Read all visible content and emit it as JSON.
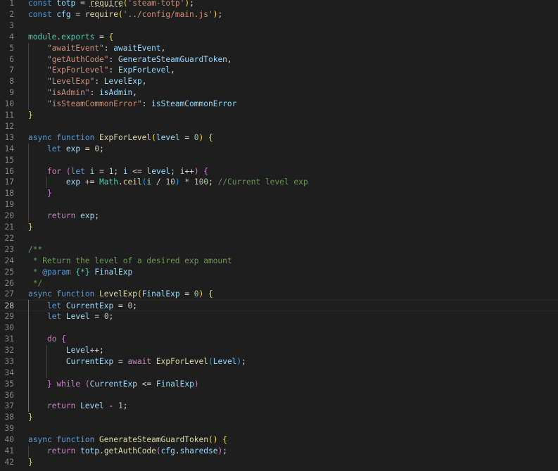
{
  "editor": {
    "lines": [
      {
        "n": "1",
        "t": [
          [
            "const ",
            "#569cd6"
          ],
          [
            "totp",
            "#9cdcfe"
          ],
          [
            " = ",
            "#d4d4d4"
          ],
          [
            "require",
            "#dcdcaa"
          ],
          [
            "(",
            "#ffd700"
          ],
          [
            "'steam-totp'",
            "#ce9178"
          ],
          [
            ")",
            "#ffd700"
          ],
          [
            ";",
            "#d4d4d4"
          ]
        ]
      },
      {
        "n": "2",
        "t": [
          [
            "const ",
            "#569cd6"
          ],
          [
            "cfg",
            "#9cdcfe"
          ],
          [
            " = ",
            "#d4d4d4"
          ],
          [
            "require",
            "#dcdcaa"
          ],
          [
            "(",
            "#ffd700"
          ],
          [
            "'../config/main.js'",
            "#ce9178"
          ],
          [
            ")",
            "#ffd700"
          ],
          [
            ";",
            "#d4d4d4"
          ]
        ]
      },
      {
        "n": "3",
        "t": []
      },
      {
        "n": "4",
        "t": [
          [
            "module",
            "#4ec9b0"
          ],
          [
            ".",
            "#d4d4d4"
          ],
          [
            "exports",
            "#4ec9b0"
          ],
          [
            " = ",
            "#d4d4d4"
          ],
          [
            "{",
            "#ffd700"
          ]
        ]
      },
      {
        "n": "5",
        "t": [
          [
            "    ",
            "#d4d4d4"
          ],
          [
            "\"awaitEvent\"",
            "#ce9178"
          ],
          [
            ": ",
            "#d4d4d4"
          ],
          [
            "awaitEvent",
            "#9cdcfe"
          ],
          [
            ",",
            "#d4d4d4"
          ]
        ]
      },
      {
        "n": "6",
        "t": [
          [
            "    ",
            "#d4d4d4"
          ],
          [
            "\"getAuthCode\"",
            "#ce9178"
          ],
          [
            ": ",
            "#d4d4d4"
          ],
          [
            "GenerateSteamGuardToken",
            "#9cdcfe"
          ],
          [
            ",",
            "#d4d4d4"
          ]
        ]
      },
      {
        "n": "7",
        "t": [
          [
            "    ",
            "#d4d4d4"
          ],
          [
            "\"ExpForLevel\"",
            "#ce9178"
          ],
          [
            ": ",
            "#d4d4d4"
          ],
          [
            "ExpForLevel",
            "#9cdcfe"
          ],
          [
            ",",
            "#d4d4d4"
          ]
        ]
      },
      {
        "n": "8",
        "t": [
          [
            "    ",
            "#d4d4d4"
          ],
          [
            "\"LevelExp\"",
            "#ce9178"
          ],
          [
            ": ",
            "#d4d4d4"
          ],
          [
            "LevelExp",
            "#9cdcfe"
          ],
          [
            ",",
            "#d4d4d4"
          ]
        ]
      },
      {
        "n": "9",
        "t": [
          [
            "    ",
            "#d4d4d4"
          ],
          [
            "\"isAdmin\"",
            "#ce9178"
          ],
          [
            ": ",
            "#d4d4d4"
          ],
          [
            "isAdmin",
            "#9cdcfe"
          ],
          [
            ",",
            "#d4d4d4"
          ]
        ]
      },
      {
        "n": "10",
        "t": [
          [
            "    ",
            "#d4d4d4"
          ],
          [
            "\"isSteamCommonError\"",
            "#ce9178"
          ],
          [
            ": ",
            "#d4d4d4"
          ],
          [
            "isSteamCommonError",
            "#9cdcfe"
          ]
        ]
      },
      {
        "n": "11",
        "t": [
          [
            "}",
            "#ffd700"
          ]
        ]
      },
      {
        "n": "12",
        "t": []
      },
      {
        "n": "13",
        "t": [
          [
            "async ",
            "#569cd6"
          ],
          [
            "function ",
            "#569cd6"
          ],
          [
            "ExpForLevel",
            "#dcdcaa"
          ],
          [
            "(",
            "#ffd700"
          ],
          [
            "level",
            "#9cdcfe"
          ],
          [
            " = ",
            "#d4d4d4"
          ],
          [
            "0",
            "#b5cea8"
          ],
          [
            ")",
            "#ffd700"
          ],
          [
            " ",
            "#d4d4d4"
          ],
          [
            "{",
            "#ffd700"
          ]
        ]
      },
      {
        "n": "14",
        "t": [
          [
            "    ",
            "#d4d4d4"
          ],
          [
            "let ",
            "#569cd6"
          ],
          [
            "exp",
            "#9cdcfe"
          ],
          [
            " = ",
            "#d4d4d4"
          ],
          [
            "0",
            "#b5cea8"
          ],
          [
            ";",
            "#d4d4d4"
          ]
        ]
      },
      {
        "n": "15",
        "t": []
      },
      {
        "n": "16",
        "t": [
          [
            "    ",
            "#d4d4d4"
          ],
          [
            "for ",
            "#c586c0"
          ],
          [
            "(",
            "#da70d6"
          ],
          [
            "let ",
            "#569cd6"
          ],
          [
            "i",
            "#9cdcfe"
          ],
          [
            " = ",
            "#d4d4d4"
          ],
          [
            "1",
            "#b5cea8"
          ],
          [
            "; ",
            "#d4d4d4"
          ],
          [
            "i",
            "#9cdcfe"
          ],
          [
            " <= ",
            "#d4d4d4"
          ],
          [
            "level",
            "#9cdcfe"
          ],
          [
            "; ",
            "#d4d4d4"
          ],
          [
            "i",
            "#9cdcfe"
          ],
          [
            "++",
            "#d4d4d4"
          ],
          [
            ")",
            "#da70d6"
          ],
          [
            " ",
            "#d4d4d4"
          ],
          [
            "{",
            "#da70d6"
          ]
        ]
      },
      {
        "n": "17",
        "t": [
          [
            "        ",
            "#d4d4d4"
          ],
          [
            "exp",
            "#9cdcfe"
          ],
          [
            " += ",
            "#d4d4d4"
          ],
          [
            "Math",
            "#4ec9b0"
          ],
          [
            ".",
            "#d4d4d4"
          ],
          [
            "ceil",
            "#dcdcaa"
          ],
          [
            "(",
            "#179fff"
          ],
          [
            "i",
            "#9cdcfe"
          ],
          [
            " / ",
            "#d4d4d4"
          ],
          [
            "10",
            "#b5cea8"
          ],
          [
            ")",
            "#179fff"
          ],
          [
            " * ",
            "#d4d4d4"
          ],
          [
            "100",
            "#b5cea8"
          ],
          [
            "; ",
            "#d4d4d4"
          ],
          [
            "//Current level exp",
            "#6a9955"
          ]
        ]
      },
      {
        "n": "18",
        "t": [
          [
            "    ",
            "#d4d4d4"
          ],
          [
            "}",
            "#da70d6"
          ]
        ]
      },
      {
        "n": "19",
        "t": []
      },
      {
        "n": "20",
        "t": [
          [
            "    ",
            "#d4d4d4"
          ],
          [
            "return ",
            "#c586c0"
          ],
          [
            "exp",
            "#9cdcfe"
          ],
          [
            ";",
            "#d4d4d4"
          ]
        ]
      },
      {
        "n": "21",
        "t": [
          [
            "}",
            "#ffd700"
          ]
        ]
      },
      {
        "n": "22",
        "t": []
      },
      {
        "n": "23",
        "t": [
          [
            "/**",
            "#6a9955"
          ]
        ]
      },
      {
        "n": "24",
        "t": [
          [
            " * Return the level of a desired exp amount",
            "#6a9955"
          ]
        ]
      },
      {
        "n": "25",
        "t": [
          [
            " * ",
            "#6a9955"
          ],
          [
            "@param ",
            "#569cd6"
          ],
          [
            "{*}",
            "#4ec9b0"
          ],
          [
            " ",
            "#6a9955"
          ],
          [
            "FinalExp",
            "#9cdcfe"
          ]
        ]
      },
      {
        "n": "26",
        "t": [
          [
            " */",
            "#6a9955"
          ]
        ]
      },
      {
        "n": "27",
        "t": [
          [
            "async ",
            "#569cd6"
          ],
          [
            "function ",
            "#569cd6"
          ],
          [
            "LevelExp",
            "#dcdcaa"
          ],
          [
            "(",
            "#ffd700"
          ],
          [
            "FinalExp",
            "#9cdcfe"
          ],
          [
            " = ",
            "#d4d4d4"
          ],
          [
            "0",
            "#b5cea8"
          ],
          [
            ")",
            "#ffd700"
          ],
          [
            " ",
            "#d4d4d4"
          ],
          [
            "{",
            "#ffd700"
          ]
        ]
      },
      {
        "n": "28",
        "t": [
          [
            "    ",
            "#d4d4d4"
          ],
          [
            "let ",
            "#569cd6"
          ],
          [
            "CurrentExp",
            "#9cdcfe"
          ],
          [
            " = ",
            "#d4d4d4"
          ],
          [
            "0",
            "#b5cea8"
          ],
          [
            ";",
            "#d4d4d4"
          ]
        ]
      },
      {
        "n": "29",
        "t": [
          [
            "    ",
            "#d4d4d4"
          ],
          [
            "let ",
            "#569cd6"
          ],
          [
            "Level",
            "#9cdcfe"
          ],
          [
            " = ",
            "#d4d4d4"
          ],
          [
            "0",
            "#b5cea8"
          ],
          [
            ";",
            "#d4d4d4"
          ]
        ]
      },
      {
        "n": "30",
        "t": []
      },
      {
        "n": "31",
        "t": [
          [
            "    ",
            "#d4d4d4"
          ],
          [
            "do ",
            "#c586c0"
          ],
          [
            "{",
            "#da70d6"
          ]
        ]
      },
      {
        "n": "32",
        "t": [
          [
            "        ",
            "#d4d4d4"
          ],
          [
            "Level",
            "#9cdcfe"
          ],
          [
            "++;",
            "#d4d4d4"
          ]
        ]
      },
      {
        "n": "33",
        "t": [
          [
            "        ",
            "#d4d4d4"
          ],
          [
            "CurrentExp",
            "#9cdcfe"
          ],
          [
            " = ",
            "#d4d4d4"
          ],
          [
            "await ",
            "#c586c0"
          ],
          [
            "ExpForLevel",
            "#dcdcaa"
          ],
          [
            "(",
            "#179fff"
          ],
          [
            "Level",
            "#9cdcfe"
          ],
          [
            ")",
            "#179fff"
          ],
          [
            ";",
            "#d4d4d4"
          ]
        ]
      },
      {
        "n": "34",
        "t": []
      },
      {
        "n": "35",
        "t": [
          [
            "    ",
            "#d4d4d4"
          ],
          [
            "} ",
            "#da70d6"
          ],
          [
            "while ",
            "#c586c0"
          ],
          [
            "(",
            "#da70d6"
          ],
          [
            "CurrentExp",
            "#9cdcfe"
          ],
          [
            " <= ",
            "#d4d4d4"
          ],
          [
            "FinalExp",
            "#9cdcfe"
          ],
          [
            ")",
            "#da70d6"
          ]
        ]
      },
      {
        "n": "36",
        "t": []
      },
      {
        "n": "37",
        "t": [
          [
            "    ",
            "#d4d4d4"
          ],
          [
            "return ",
            "#c586c0"
          ],
          [
            "Level",
            "#9cdcfe"
          ],
          [
            " - ",
            "#d4d4d4"
          ],
          [
            "1",
            "#b5cea8"
          ],
          [
            ";",
            "#d4d4d4"
          ]
        ]
      },
      {
        "n": "38",
        "t": [
          [
            "}",
            "#ffd700"
          ]
        ]
      },
      {
        "n": "39",
        "t": []
      },
      {
        "n": "40",
        "t": [
          [
            "async ",
            "#569cd6"
          ],
          [
            "function ",
            "#569cd6"
          ],
          [
            "GenerateSteamGuardToken",
            "#dcdcaa"
          ],
          [
            "()",
            "#ffd700"
          ],
          [
            " ",
            "#d4d4d4"
          ],
          [
            "{",
            "#ffd700"
          ]
        ]
      },
      {
        "n": "41",
        "t": [
          [
            "    ",
            "#d4d4d4"
          ],
          [
            "return ",
            "#c586c0"
          ],
          [
            "totp",
            "#9cdcfe"
          ],
          [
            ".",
            "#d4d4d4"
          ],
          [
            "getAuthCode",
            "#dcdcaa"
          ],
          [
            "(",
            "#da70d6"
          ],
          [
            "cfg",
            "#9cdcfe"
          ],
          [
            ".",
            "#d4d4d4"
          ],
          [
            "sharedse",
            "#9cdcfe"
          ],
          [
            ")",
            "#da70d6"
          ],
          [
            ";",
            "#d4d4d4"
          ]
        ]
      },
      {
        "n": "42",
        "t": [
          [
            "}",
            "#ffd700"
          ]
        ]
      }
    ],
    "active_line": "28",
    "colors": {
      "background": "#1e1e1e",
      "line_number": "#858585",
      "active_line_number": "#c6c6c6",
      "indent_guide": "#404040",
      "active_indent_guide": "#707070"
    }
  }
}
